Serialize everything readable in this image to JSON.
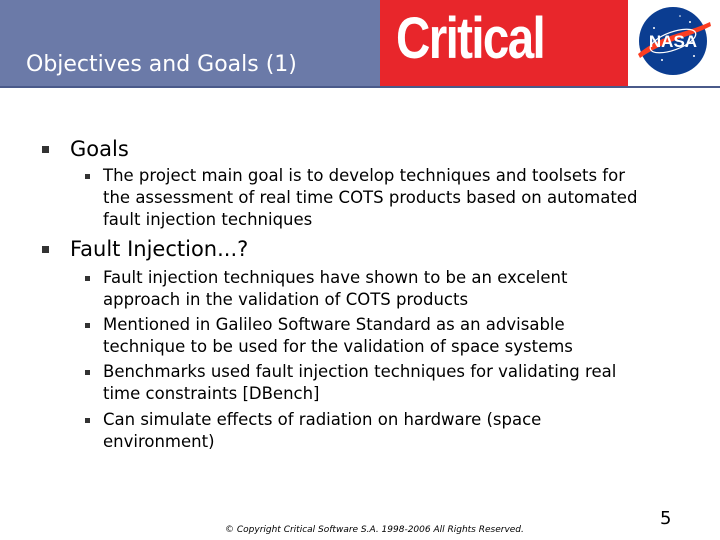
{
  "slide": {
    "title": "Objectives and Goals (1)",
    "logo_text": "Critical",
    "nasa_text": "NASA",
    "page_number": "5",
    "copyright": "© Copyright Critical Software S.A. 1998-2006 All Rights Reserved."
  },
  "sections": [
    {
      "heading": "Goals",
      "bullets": [
        [
          "The project main goal is to develop techniques and toolsets for",
          "the assessment of real time COTS products based on automated",
          "fault injection techniques"
        ]
      ]
    },
    {
      "heading": "Fault Injection...?",
      "bullets": [
        [
          "Fault injection techniques have shown to be an excelent",
          "approach in the validation of COTS products"
        ],
        [
          "Mentioned in Galileo Software Standard as an advisable",
          "technique to be used for the validation of space systems"
        ],
        [
          "Benchmarks used fault injection techniques for validating real",
          "time constraints [DBench]"
        ],
        [
          "Can simulate effects of radiation on hardware (space",
          "environment)"
        ]
      ]
    }
  ],
  "colors": {
    "title_band": "#6b7aa8",
    "logo_band": "#e8262b",
    "nasa_blue": "#0b3d91",
    "nasa_red": "#fc3d21"
  }
}
